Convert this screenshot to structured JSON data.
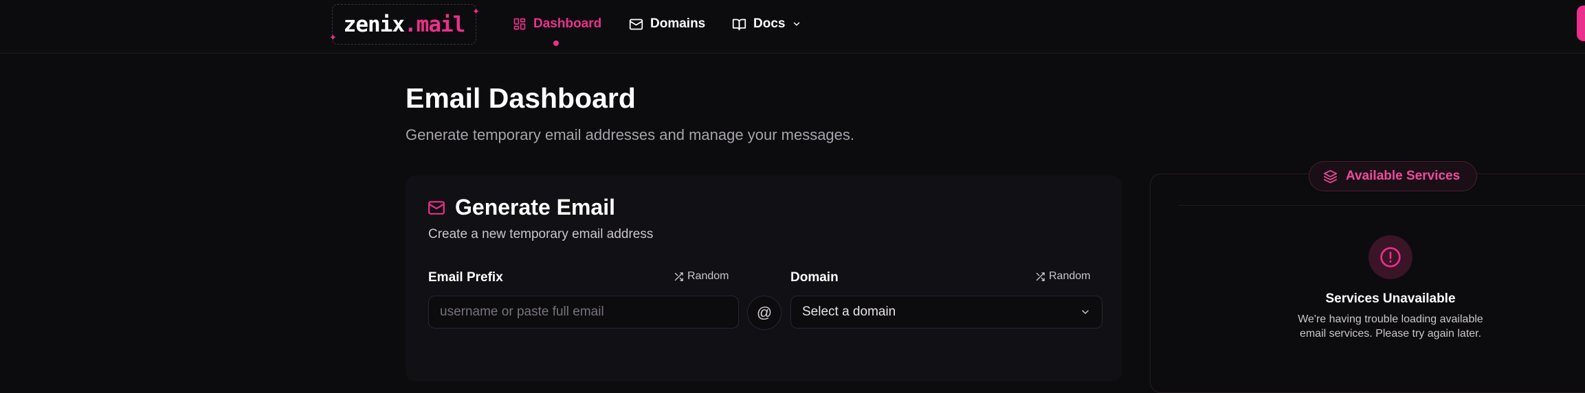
{
  "header": {
    "logo": {
      "main": "zenix",
      "suffix": ".mail"
    },
    "nav": [
      {
        "label": "Dashboard",
        "icon": "dashboard-grid-icon",
        "active": true
      },
      {
        "label": "Domains",
        "icon": "mail-icon",
        "active": false
      },
      {
        "label": "Docs",
        "icon": "book-icon",
        "active": false,
        "dropdown": true
      }
    ]
  },
  "page": {
    "title": "Email Dashboard",
    "subtitle": "Generate temporary email addresses and manage your messages."
  },
  "generate": {
    "title": "Generate Email",
    "subtitle": "Create a new temporary email address",
    "prefix_label": "Email Prefix",
    "prefix_placeholder": "username or paste full email",
    "prefix_value": "",
    "random_label": "Random",
    "at_symbol": "@",
    "domain_label": "Domain",
    "domain_value": "Select a domain"
  },
  "services": {
    "pill_label": "Available Services",
    "status_title": "Services Unavailable",
    "status_message": "We're having trouble loading available email services. Please try again later."
  },
  "colors": {
    "accent": "#ec2f8c",
    "background": "#0c0b0e",
    "card": "#111014",
    "muted_text": "#a6a3ab"
  }
}
